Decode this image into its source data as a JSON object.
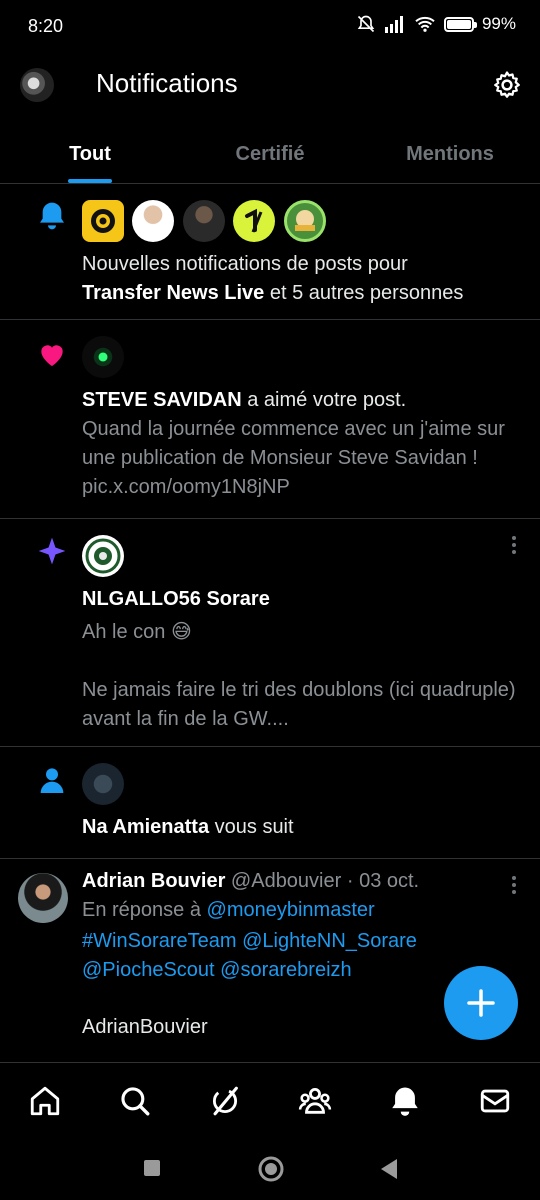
{
  "status": {
    "time": "8:20",
    "battery": "99%",
    "battery_level": 0.99
  },
  "header": {
    "title": "Notifications"
  },
  "tabs": [
    {
      "label": "Tout",
      "active": true
    },
    {
      "label": "Certifié",
      "active": false
    },
    {
      "label": "Mentions",
      "active": false
    }
  ],
  "notifications": [
    {
      "type": "bell",
      "line1": "Nouvelles notifications de posts pour",
      "bold": "Transfer News Live",
      "line2_suffix": " et 5 autres personnes"
    },
    {
      "type": "like",
      "actor": "STEVE SAVIDAN",
      "action": " a aimé votre post.",
      "snippet": "Quand la journée commence avec un j'aime sur une publication de Monsieur Steve Savidan ! pic.x.com/oomy1N8jNP"
    },
    {
      "type": "sparkle",
      "actor": "NLGALLO56 Sorare",
      "line1": "Ah le con 😅",
      "line2": "Ne jamais faire le tri des doublons (ici quadruple) avant la fin de la GW...."
    },
    {
      "type": "follow",
      "actor": "Na Amienatta",
      "action": " vous suit"
    },
    {
      "type": "reply",
      "name": "Adrian Bouvier",
      "handle": "@Adbouvier",
      "date": "· 03 oct.",
      "reply_prefix": "En réponse à ",
      "reply_to": "@moneybinmaster",
      "mentions": [
        "#WinSorareTeam",
        "@LighteNN_Sorare",
        "@PiocheScout",
        "@sorarebreizh"
      ],
      "body": "AdrianBouvier"
    }
  ],
  "colors": {
    "accent": "#1d9bf0",
    "like": "#f91880",
    "sparkle": "#7856ff",
    "bg": "#000000"
  }
}
